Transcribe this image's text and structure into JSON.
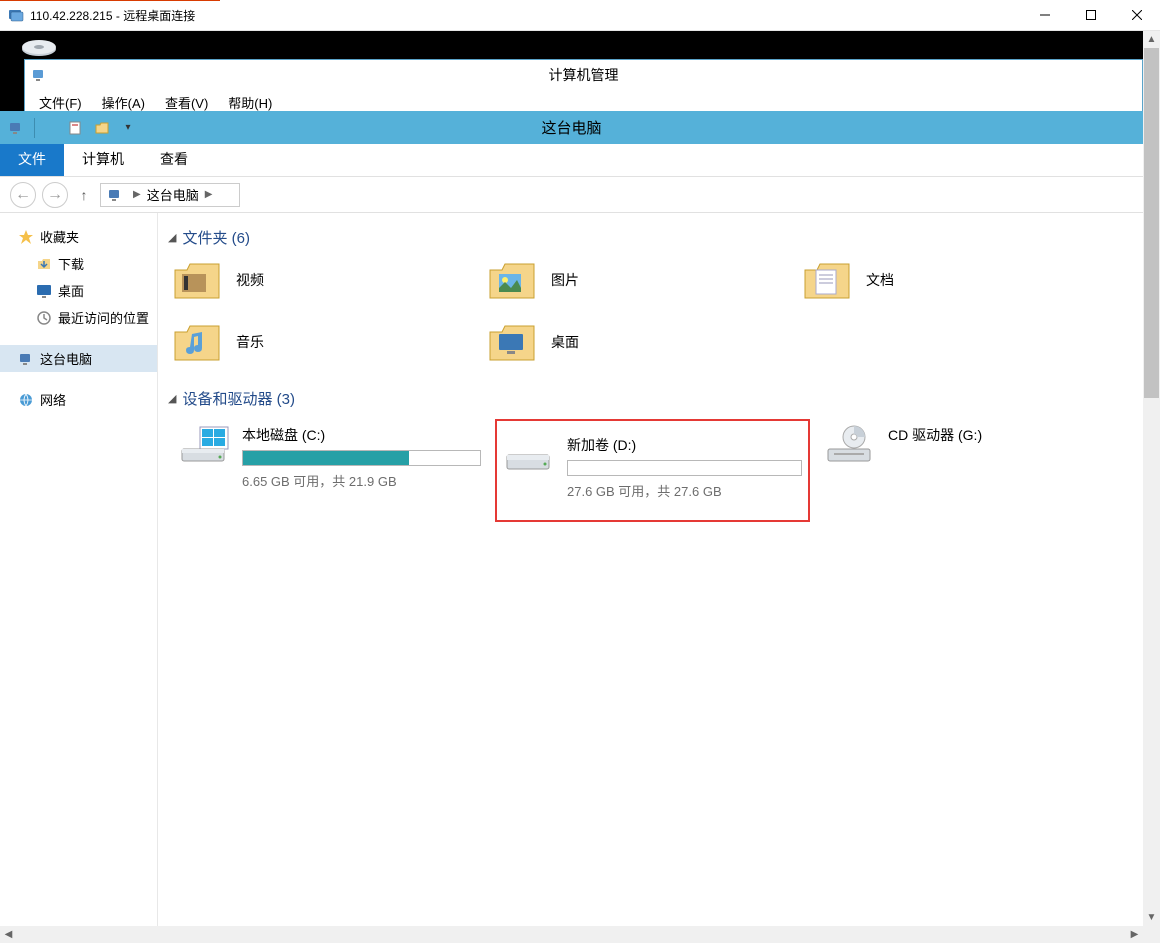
{
  "rdp": {
    "title": "110.42.228.215 - 远程桌面连接"
  },
  "mgmt": {
    "title": "计算机管理",
    "menu": [
      "文件(F)",
      "操作(A)",
      "查看(V)",
      "帮助(H)"
    ]
  },
  "explorer": {
    "title": "这台电脑",
    "tabs": {
      "file": "文件",
      "computer": "计算机",
      "view": "查看"
    },
    "breadcrumb": "这台电脑",
    "sidebar": {
      "favorites": "收藏夹",
      "downloads": "下载",
      "desktop": "桌面",
      "recent": "最近访问的位置",
      "thispc": "这台电脑",
      "network": "网络"
    },
    "folders_header": "文件夹 (6)",
    "folders": [
      {
        "label": "视频"
      },
      {
        "label": "图片"
      },
      {
        "label": "文档"
      },
      {
        "label": "音乐"
      },
      {
        "label": "桌面"
      }
    ],
    "drives_header": "设备和驱动器 (3)",
    "drives": [
      {
        "name": "本地磁盘 (C:)",
        "status": "6.65 GB 可用，共 21.9 GB",
        "fill_pct": 70
      },
      {
        "name": "新加卷 (D:)",
        "status": "27.6 GB 可用，共 27.6 GB",
        "fill_pct": 0,
        "highlight": true
      },
      {
        "name": "CD 驱动器 (G:)",
        "status": "",
        "no_bar": true
      }
    ]
  }
}
